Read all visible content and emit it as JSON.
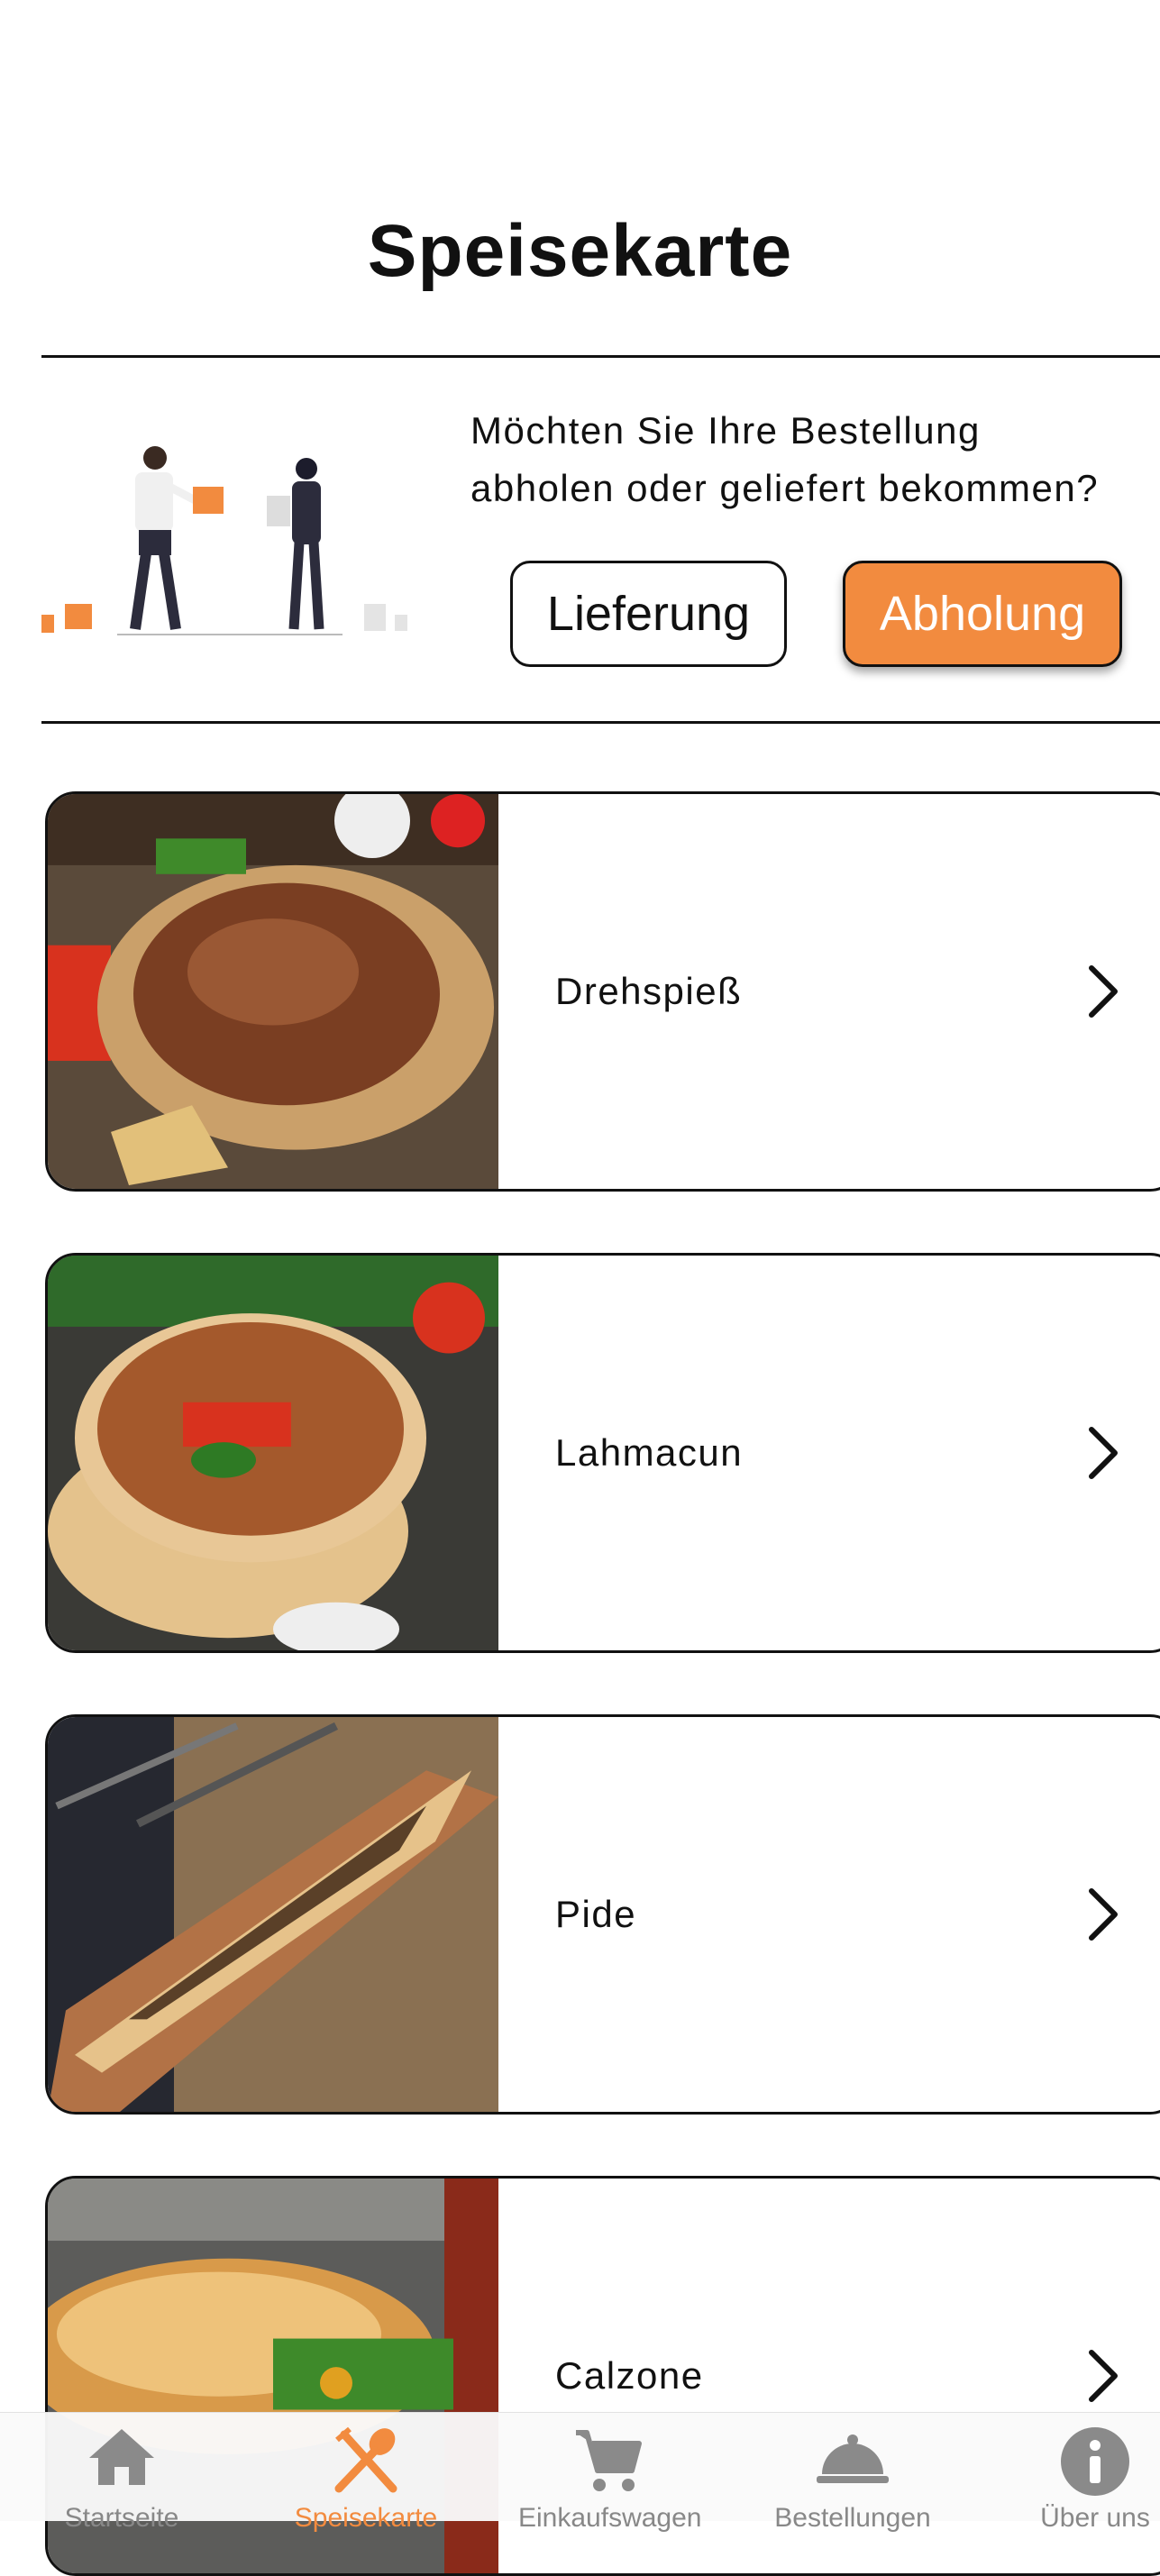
{
  "header": {
    "title": "Speisekarte"
  },
  "delivery_prompt": {
    "question_line1": "Möchten Sie Ihre Bestellung",
    "question_line2": "abholen oder geliefert bekommen?",
    "option_delivery": "Lieferung",
    "option_pickup": "Abholung",
    "selected": "Abholung"
  },
  "categories": [
    {
      "name": "Drehspieß",
      "icon": "chevron-right-icon"
    },
    {
      "name": "Lahmacun",
      "icon": "chevron-right-icon"
    },
    {
      "name": "Pide",
      "icon": "chevron-right-icon"
    },
    {
      "name": "Calzone",
      "icon": "chevron-right-icon"
    }
  ],
  "tabbar": {
    "items": [
      {
        "label": "Startseite",
        "icon": "home-icon"
      },
      {
        "label": "Speisekarte",
        "icon": "fork-spoon-icon",
        "active": true
      },
      {
        "label": "Einkaufswagen",
        "icon": "cart-icon"
      },
      {
        "label": "Bestellungen",
        "icon": "cloche-icon"
      },
      {
        "label": "Über uns",
        "icon": "info-icon"
      }
    ]
  },
  "colors": {
    "accent": "#f28b3f",
    "text": "#111111",
    "inactive_tab": "#888888"
  }
}
